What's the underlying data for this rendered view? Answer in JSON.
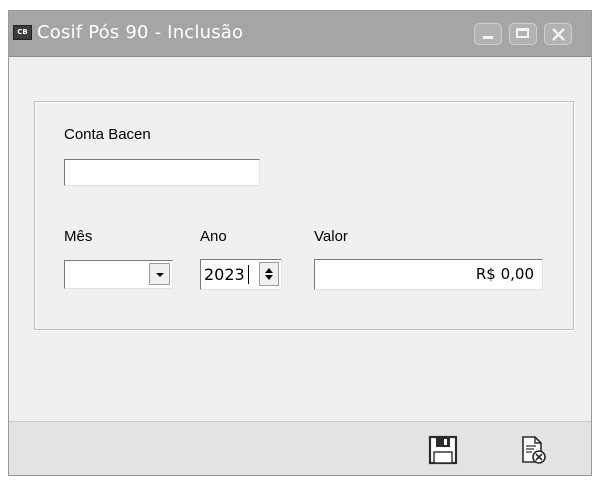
{
  "window": {
    "app_icon_text": "CB",
    "title": "Cosif Pós 90 - Inclusão",
    "controls": [
      {
        "name": "minimize",
        "icon": "minimize-icon"
      },
      {
        "name": "maximize",
        "icon": "maximize-icon"
      },
      {
        "name": "close",
        "icon": "close-icon"
      }
    ]
  },
  "form": {
    "conta_bacen": {
      "label": "Conta Bacen",
      "value": ""
    },
    "mes": {
      "label": "Mês",
      "selected": ""
    },
    "ano": {
      "label": "Ano",
      "value": "2023"
    },
    "valor": {
      "label": "Valor",
      "value": "R$ 0,00"
    }
  },
  "footer": {
    "actions": [
      {
        "name": "save",
        "icon": "floppy-disk-icon"
      },
      {
        "name": "cancel",
        "icon": "document-cancel-icon"
      }
    ]
  },
  "colors": {
    "titlebar": "#a5a5a5",
    "window_bg": "#f0f0f0",
    "footer_bg": "#e3e3e3"
  }
}
